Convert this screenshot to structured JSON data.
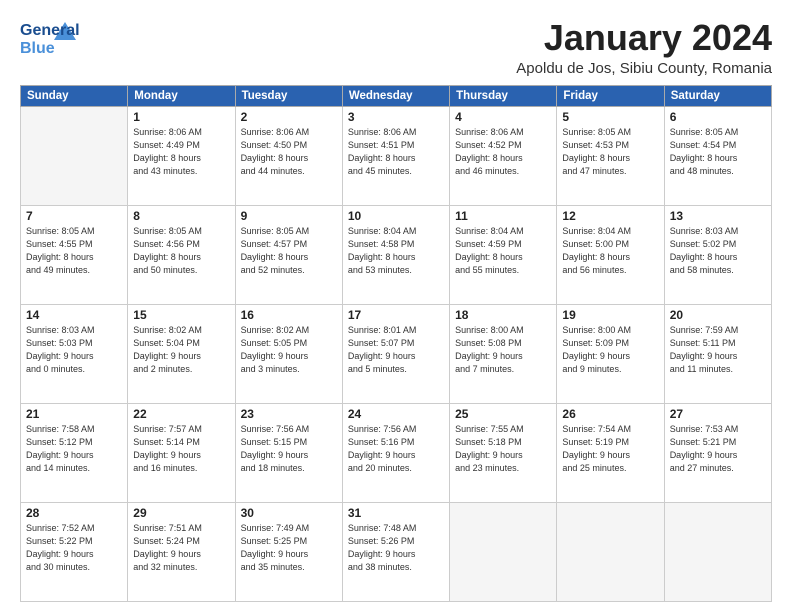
{
  "header": {
    "logo_general": "General",
    "logo_blue": "Blue",
    "month_title": "January 2024",
    "location": "Apoldu de Jos, Sibiu County, Romania"
  },
  "days_of_week": [
    "Sunday",
    "Monday",
    "Tuesday",
    "Wednesday",
    "Thursday",
    "Friday",
    "Saturday"
  ],
  "weeks": [
    [
      {
        "day": "",
        "info": ""
      },
      {
        "day": "1",
        "info": "Sunrise: 8:06 AM\nSunset: 4:49 PM\nDaylight: 8 hours\nand 43 minutes."
      },
      {
        "day": "2",
        "info": "Sunrise: 8:06 AM\nSunset: 4:50 PM\nDaylight: 8 hours\nand 44 minutes."
      },
      {
        "day": "3",
        "info": "Sunrise: 8:06 AM\nSunset: 4:51 PM\nDaylight: 8 hours\nand 45 minutes."
      },
      {
        "day": "4",
        "info": "Sunrise: 8:06 AM\nSunset: 4:52 PM\nDaylight: 8 hours\nand 46 minutes."
      },
      {
        "day": "5",
        "info": "Sunrise: 8:05 AM\nSunset: 4:53 PM\nDaylight: 8 hours\nand 47 minutes."
      },
      {
        "day": "6",
        "info": "Sunrise: 8:05 AM\nSunset: 4:54 PM\nDaylight: 8 hours\nand 48 minutes."
      }
    ],
    [
      {
        "day": "7",
        "info": "Sunrise: 8:05 AM\nSunset: 4:55 PM\nDaylight: 8 hours\nand 49 minutes."
      },
      {
        "day": "8",
        "info": "Sunrise: 8:05 AM\nSunset: 4:56 PM\nDaylight: 8 hours\nand 50 minutes."
      },
      {
        "day": "9",
        "info": "Sunrise: 8:05 AM\nSunset: 4:57 PM\nDaylight: 8 hours\nand 52 minutes."
      },
      {
        "day": "10",
        "info": "Sunrise: 8:04 AM\nSunset: 4:58 PM\nDaylight: 8 hours\nand 53 minutes."
      },
      {
        "day": "11",
        "info": "Sunrise: 8:04 AM\nSunset: 4:59 PM\nDaylight: 8 hours\nand 55 minutes."
      },
      {
        "day": "12",
        "info": "Sunrise: 8:04 AM\nSunset: 5:00 PM\nDaylight: 8 hours\nand 56 minutes."
      },
      {
        "day": "13",
        "info": "Sunrise: 8:03 AM\nSunset: 5:02 PM\nDaylight: 8 hours\nand 58 minutes."
      }
    ],
    [
      {
        "day": "14",
        "info": "Sunrise: 8:03 AM\nSunset: 5:03 PM\nDaylight: 9 hours\nand 0 minutes."
      },
      {
        "day": "15",
        "info": "Sunrise: 8:02 AM\nSunset: 5:04 PM\nDaylight: 9 hours\nand 2 minutes."
      },
      {
        "day": "16",
        "info": "Sunrise: 8:02 AM\nSunset: 5:05 PM\nDaylight: 9 hours\nand 3 minutes."
      },
      {
        "day": "17",
        "info": "Sunrise: 8:01 AM\nSunset: 5:07 PM\nDaylight: 9 hours\nand 5 minutes."
      },
      {
        "day": "18",
        "info": "Sunrise: 8:00 AM\nSunset: 5:08 PM\nDaylight: 9 hours\nand 7 minutes."
      },
      {
        "day": "19",
        "info": "Sunrise: 8:00 AM\nSunset: 5:09 PM\nDaylight: 9 hours\nand 9 minutes."
      },
      {
        "day": "20",
        "info": "Sunrise: 7:59 AM\nSunset: 5:11 PM\nDaylight: 9 hours\nand 11 minutes."
      }
    ],
    [
      {
        "day": "21",
        "info": "Sunrise: 7:58 AM\nSunset: 5:12 PM\nDaylight: 9 hours\nand 14 minutes."
      },
      {
        "day": "22",
        "info": "Sunrise: 7:57 AM\nSunset: 5:14 PM\nDaylight: 9 hours\nand 16 minutes."
      },
      {
        "day": "23",
        "info": "Sunrise: 7:56 AM\nSunset: 5:15 PM\nDaylight: 9 hours\nand 18 minutes."
      },
      {
        "day": "24",
        "info": "Sunrise: 7:56 AM\nSunset: 5:16 PM\nDaylight: 9 hours\nand 20 minutes."
      },
      {
        "day": "25",
        "info": "Sunrise: 7:55 AM\nSunset: 5:18 PM\nDaylight: 9 hours\nand 23 minutes."
      },
      {
        "day": "26",
        "info": "Sunrise: 7:54 AM\nSunset: 5:19 PM\nDaylight: 9 hours\nand 25 minutes."
      },
      {
        "day": "27",
        "info": "Sunrise: 7:53 AM\nSunset: 5:21 PM\nDaylight: 9 hours\nand 27 minutes."
      }
    ],
    [
      {
        "day": "28",
        "info": "Sunrise: 7:52 AM\nSunset: 5:22 PM\nDaylight: 9 hours\nand 30 minutes."
      },
      {
        "day": "29",
        "info": "Sunrise: 7:51 AM\nSunset: 5:24 PM\nDaylight: 9 hours\nand 32 minutes."
      },
      {
        "day": "30",
        "info": "Sunrise: 7:49 AM\nSunset: 5:25 PM\nDaylight: 9 hours\nand 35 minutes."
      },
      {
        "day": "31",
        "info": "Sunrise: 7:48 AM\nSunset: 5:26 PM\nDaylight: 9 hours\nand 38 minutes."
      },
      {
        "day": "",
        "info": ""
      },
      {
        "day": "",
        "info": ""
      },
      {
        "day": "",
        "info": ""
      }
    ]
  ]
}
